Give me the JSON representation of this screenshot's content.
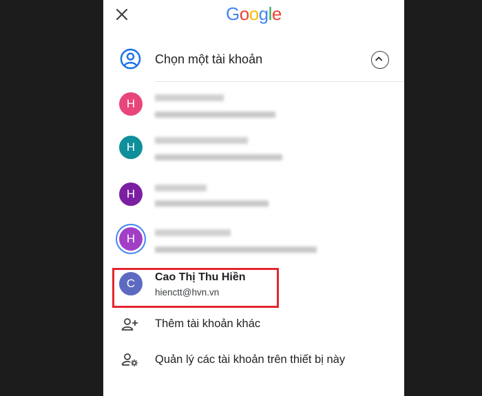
{
  "header": {
    "logo": {
      "letters": [
        "G",
        "o",
        "o",
        "g",
        "l",
        "e"
      ],
      "colors": [
        "#4285F4",
        "#EA4335",
        "#FBBC05",
        "#4285F4",
        "#34A853",
        "#EA4335"
      ]
    }
  },
  "chooser": {
    "title": "Chọn một tài khoản"
  },
  "accounts": [
    {
      "initial": "H",
      "color": "#e8457a",
      "name": "",
      "email": ""
    },
    {
      "initial": "H",
      "color": "#0f8f9a",
      "name": "",
      "email": ""
    },
    {
      "initial": "H",
      "color": "#7b1fa2",
      "name": "",
      "email": ""
    },
    {
      "initial": "H",
      "color": "#a23fc7",
      "name": "",
      "email": ""
    },
    {
      "initial": "C",
      "color": "#5c6bc0",
      "name": "Cao Thị Thu Hiền",
      "email": "hienctt@hvn.vn"
    }
  ],
  "actions": {
    "add_account": "Thêm tài khoản khác",
    "manage_accounts": "Quản lý các tài khoản trên thiết bị này"
  },
  "colors": {
    "highlight": "#e3262e",
    "background": "#1c1c1c"
  }
}
